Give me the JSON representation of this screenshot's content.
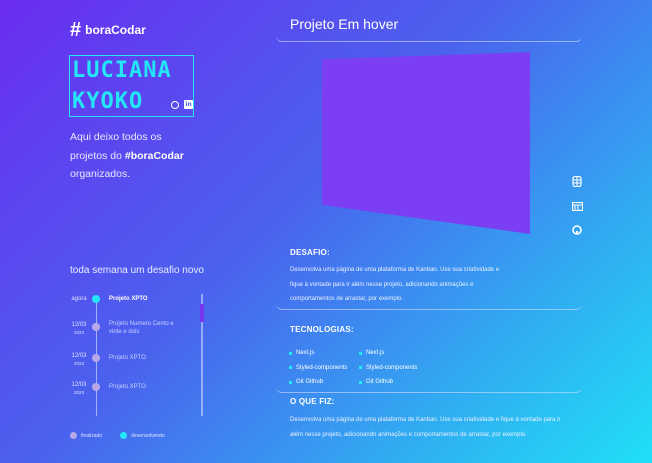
{
  "brand": {
    "symbol": "#",
    "name": "boraCodar"
  },
  "profile": {
    "name_line1": "LUCIANA",
    "name_line2": "KYOKO",
    "intro_line1": "Aqui deixo todos os",
    "intro_line2_prefix": "projetos do ",
    "intro_hashtag": "#boraCodar",
    "intro_line3": "organizados."
  },
  "weekly_heading": "toda semana um desafio novo",
  "timeline": {
    "items": [
      {
        "date": "agora",
        "year": "",
        "title": "Projeto XPTO",
        "active": true
      },
      {
        "date": "12/03",
        "year": "2023",
        "title": "Projeto Numero Cento e vinte e dois",
        "active": false
      },
      {
        "date": "12/03",
        "year": "2023",
        "title": "Projeto XPTO",
        "active": false
      },
      {
        "date": "12/03",
        "year": "2023",
        "title": "Projeto XPTO",
        "active": false
      }
    ],
    "legend": {
      "done": "finalizado",
      "in_progress": "desenvolvendo"
    }
  },
  "project": {
    "title": "Projeto Em hover",
    "challenge_heading": "DESAFIO:",
    "challenge_line1": "Desenvolva uma página de uma plataforma de Kanban. Use sua criatividade e",
    "challenge_line2": "fique à vontade para ir além nesse projeto, adicionando animações e",
    "challenge_line3": "comportamentos de arrastar, por exemplo.",
    "tech_heading": "TECNOLOGIAS:",
    "tech_col1": [
      "Next.js",
      "Styled-components",
      "Git Github"
    ],
    "tech_col2": [
      "Next.js",
      "Styled-components",
      "Git Github"
    ],
    "done_heading": "O QUE FIZ:",
    "done_line1": "Desenvolva uma página de uma plataforma de Kanban. Use sua criatividade e fique à vontade para ir",
    "done_line2": "além nesse projeto, adicionando animações e comportamentos de arrastar, por exemplo."
  },
  "icons": {
    "profile": [
      "github-icon",
      "linkedin-icon"
    ],
    "side": [
      "figma-icon",
      "layout-icon",
      "github-icon"
    ]
  },
  "colors": {
    "accent": "#23e6f7",
    "preview": "#7c3ef2",
    "done_dot": "#b9a8e8"
  }
}
